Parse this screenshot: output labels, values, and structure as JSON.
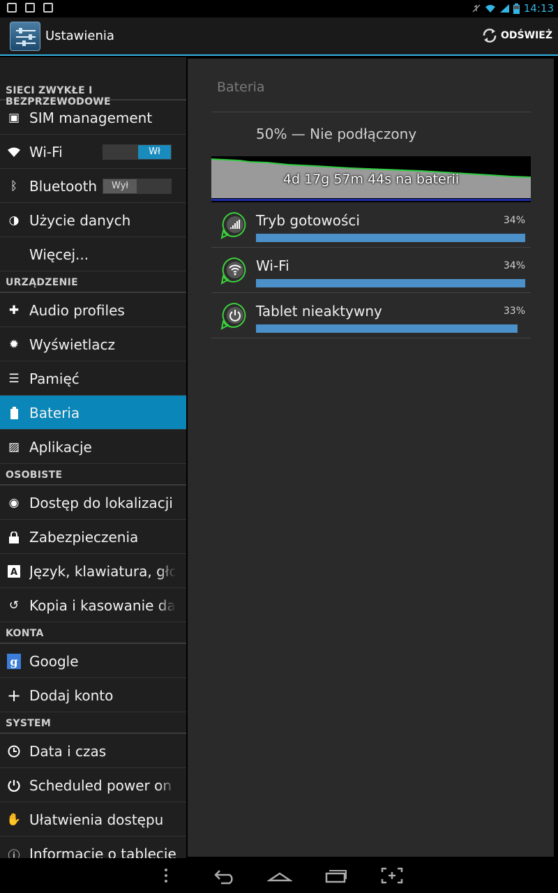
{
  "status_bar": {
    "time": "14:13"
  },
  "action_bar": {
    "title": "Ustawienia",
    "refresh_label": "ODŚWIEŻ"
  },
  "sidebar": {
    "sections": [
      {
        "header": "SIECI ZWYKŁE I BEZPRZEWODOWE",
        "items": [
          {
            "label": "SIM management",
            "icon": "sim-icon"
          },
          {
            "label": "Wi-Fi",
            "icon": "wifi-icon",
            "toggle": "Wł"
          },
          {
            "label": "Bluetooth",
            "icon": "bluetooth-icon",
            "toggle": "Wył"
          },
          {
            "label": "Użycie danych",
            "icon": "data-usage-icon"
          },
          {
            "label": "Więcej...",
            "icon": ""
          }
        ]
      },
      {
        "header": "URZĄDZENIE",
        "items": [
          {
            "label": "Audio profiles",
            "icon": "audio-icon"
          },
          {
            "label": "Wyświetlacz",
            "icon": "display-icon"
          },
          {
            "label": "Pamięć",
            "icon": "storage-icon"
          },
          {
            "label": "Bateria",
            "icon": "battery-icon",
            "active": true
          },
          {
            "label": "Aplikacje",
            "icon": "apps-icon"
          }
        ]
      },
      {
        "header": "OSOBISTE",
        "items": [
          {
            "label": "Dostęp do lokalizacji",
            "icon": "location-icon"
          },
          {
            "label": "Zabezpieczenia",
            "icon": "lock-icon"
          },
          {
            "label": "Język, klawiatura, głos",
            "icon": "language-icon"
          },
          {
            "label": "Kopia i kasowanie danych",
            "icon": "backup-icon"
          }
        ]
      },
      {
        "header": "KONTA",
        "items": [
          {
            "label": "Google",
            "icon": "google-icon"
          },
          {
            "label": "Dodaj konto",
            "icon": "add-icon"
          }
        ]
      },
      {
        "header": "SYSTEM",
        "items": [
          {
            "label": "Data i czas",
            "icon": "clock-icon"
          },
          {
            "label": "Scheduled power on & off",
            "icon": "power-schedule-icon"
          },
          {
            "label": "Ułatwienia dostępu",
            "icon": "hand-icon"
          },
          {
            "label": "Informacje o tablecie",
            "icon": "info-icon"
          }
        ]
      }
    ]
  },
  "battery": {
    "title": "Bateria",
    "summary": "50% — Nie podłączony",
    "graph_label": "4d 17g 57m 44s na baterii",
    "usage": [
      {
        "label": "Tryb gotowości",
        "percent_text": "34%",
        "level": 0.34,
        "icon": "signal-icon"
      },
      {
        "label": "Wi-Fi",
        "percent_text": "34%",
        "level": 0.34,
        "icon": "wifi-icon"
      },
      {
        "label": "Tablet nieaktywny",
        "percent_text": "33%",
        "level": 0.33,
        "icon": "power-icon"
      }
    ]
  },
  "colors": {
    "accent": "#33b5e5",
    "active_item": "#0a86b8",
    "usage_bar": "#4c90c9",
    "graph_line": "#2ecc40"
  }
}
